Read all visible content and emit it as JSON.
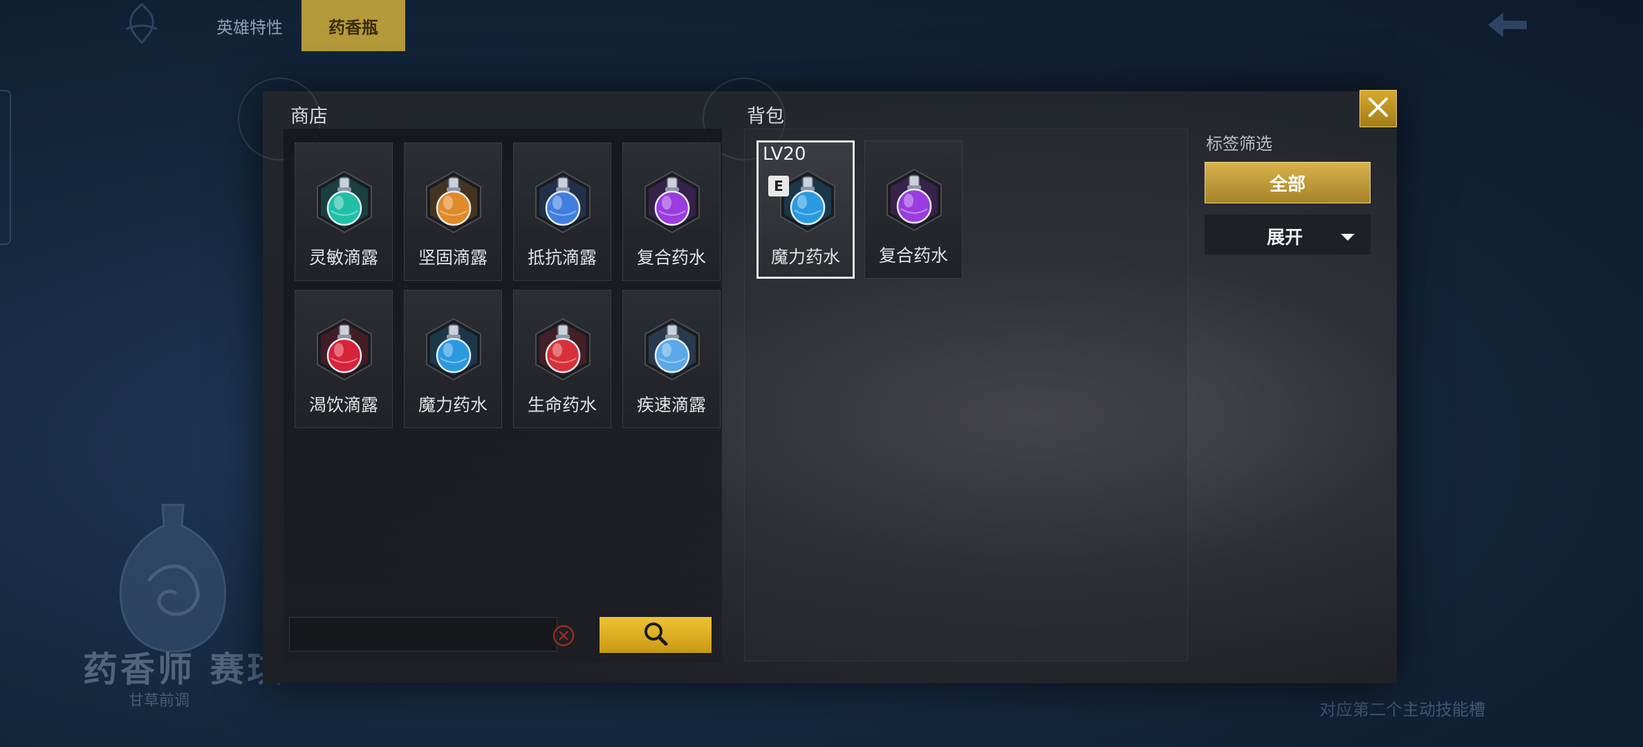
{
  "top_tabs": [
    {
      "label": "英雄特性",
      "active": false
    },
    {
      "label": "药香瓶",
      "active": true
    }
  ],
  "background": {
    "title": "药香师 赛琪",
    "subtitle": "甘草前调",
    "skill_note": "对应第二个主动技能槽"
  },
  "shop": {
    "title": "商店",
    "items": [
      {
        "label": "灵敏滴露",
        "icon": "green-teal-potion-icon",
        "color": "#20c0a8"
      },
      {
        "label": "坚固滴露",
        "icon": "orange-shield-potion-icon",
        "color": "#e08a2a"
      },
      {
        "label": "抵抗滴露",
        "icon": "blue-orange-potion-icon",
        "color": "#3f7fe0"
      },
      {
        "label": "复合药水",
        "icon": "purple-potion-icon",
        "color": "#9a3ce0"
      },
      {
        "label": "渴饮滴露",
        "icon": "red-potion-icon",
        "color": "#d8233a"
      },
      {
        "label": "魔力药水",
        "icon": "blue-potion-icon",
        "color": "#2a9ae0"
      },
      {
        "label": "生命药水",
        "icon": "red-green-potion-icon",
        "color": "#d8303a"
      },
      {
        "label": "疾速滴露",
        "icon": "light-blue-potion-icon",
        "color": "#5aa8e8"
      }
    ],
    "search_placeholder": ""
  },
  "bag": {
    "title": "背包",
    "items": [
      {
        "label": "魔力药水",
        "icon": "blue-potion-icon",
        "color": "#2a9ae0",
        "level": "LV20",
        "badge": "E",
        "selected": true
      },
      {
        "label": "复合药水",
        "icon": "purple-potion-icon",
        "color": "#9a3ce0",
        "level": "",
        "badge": "",
        "selected": false
      }
    ]
  },
  "filter": {
    "title": "标签筛选",
    "all_label": "全部",
    "expand_label": "展开"
  },
  "colors": {
    "accent_gold": "#d8aa2c",
    "background_blue": "#15283f"
  }
}
